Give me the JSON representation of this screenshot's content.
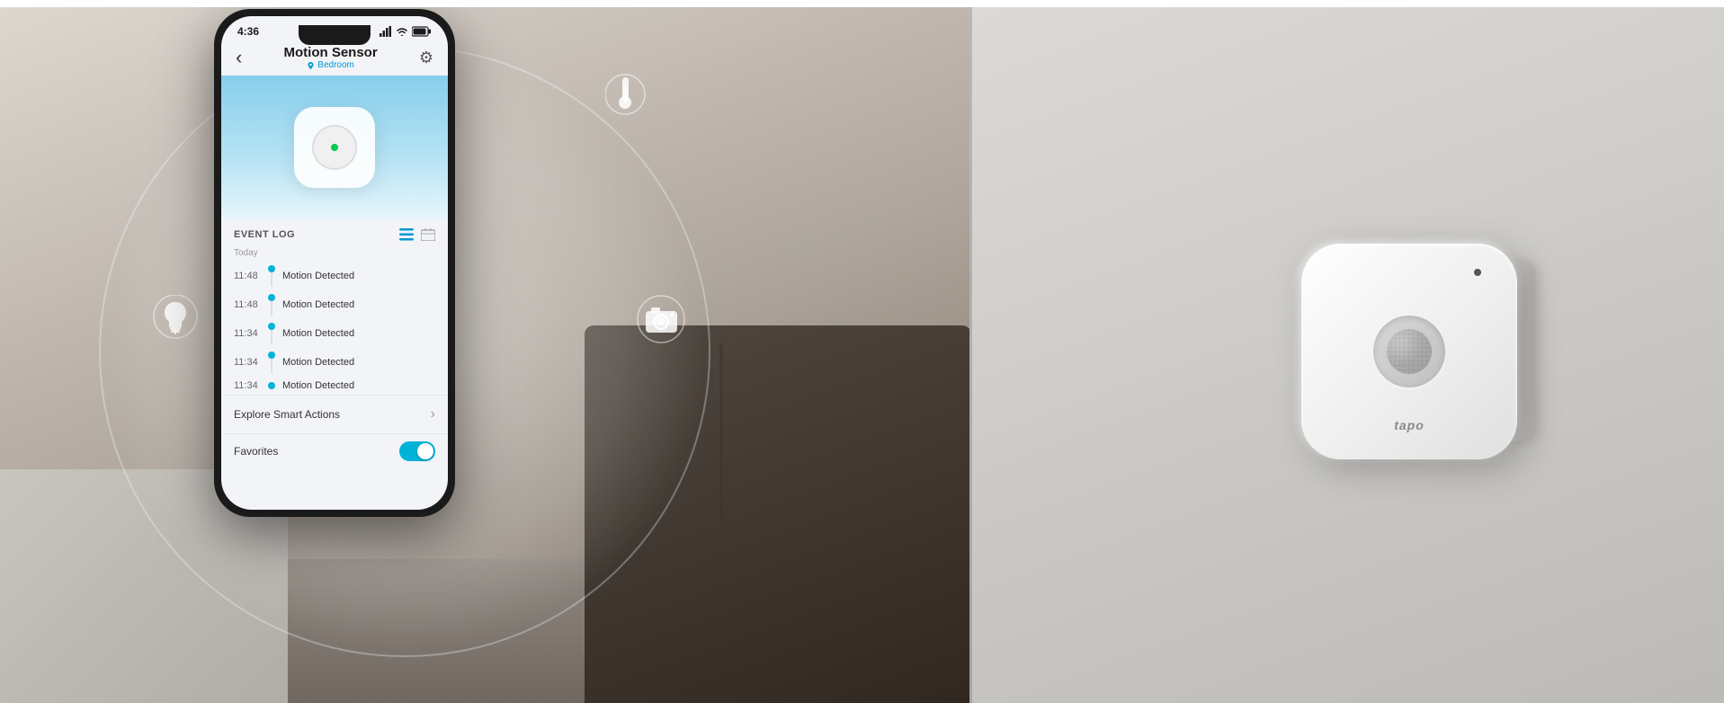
{
  "topBar": {
    "visible": true
  },
  "background": {
    "leftColor": "#c0b8b0",
    "rightColor": "#d0ccc8"
  },
  "floatingIcons": {
    "fan": "✦",
    "bulb": "✦",
    "thermometer": "✦",
    "camera": "✦"
  },
  "phone": {
    "statusBar": {
      "time": "4:36",
      "signal": "▲",
      "wifi": "WiFi",
      "battery": "Battery"
    },
    "nav": {
      "title": "Motion Sensor",
      "subtitle": "Bedroom",
      "backLabel": "‹",
      "settingsLabel": "⚙"
    },
    "eventLog": {
      "title": "EVENT LOG",
      "dateLabel": "Today",
      "events": [
        {
          "time": "11:48",
          "label": "Motion Detected"
        },
        {
          "time": "11:48",
          "label": "Motion Detected"
        },
        {
          "time": "11:34",
          "label": "Motion Detected"
        },
        {
          "time": "11:34",
          "label": "Motion Detected"
        },
        {
          "time": "11:34",
          "label": "Motion Detected"
        }
      ]
    },
    "smartActions": {
      "label": "Explore Smart Actions",
      "arrowLabel": "›"
    },
    "favorites": {
      "label": "Favorites",
      "toggleOn": true
    }
  },
  "device": {
    "brand": "tapo",
    "ledColor": "#555555"
  }
}
